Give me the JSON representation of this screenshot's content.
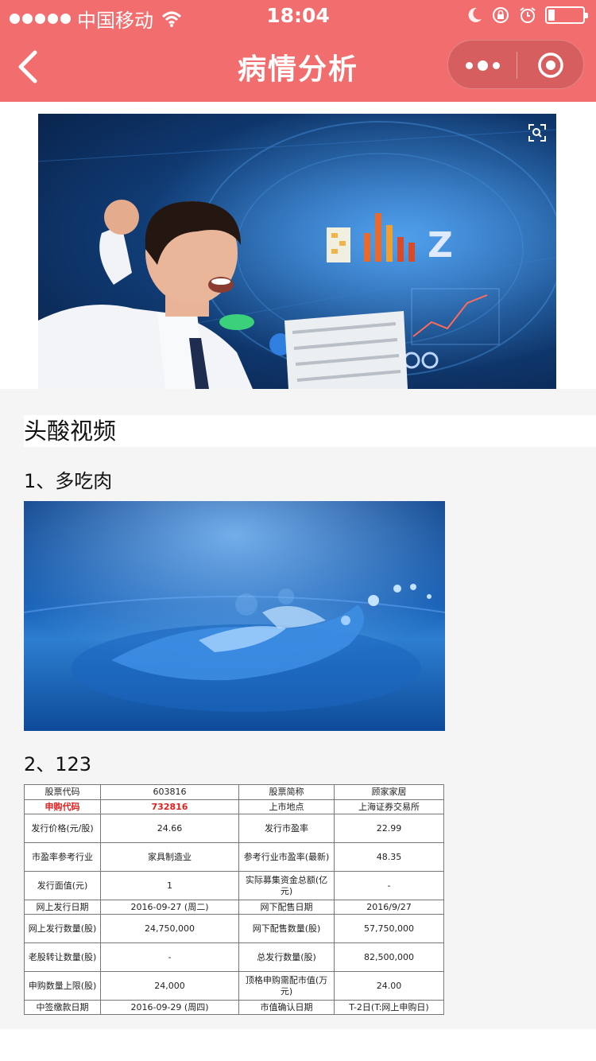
{
  "status_bar": {
    "carrier": "中国移动",
    "time": "18:04"
  },
  "nav": {
    "title": "病情分析"
  },
  "section": {
    "title": "头酸视频"
  },
  "items": [
    {
      "title": "1、多吃肉"
    },
    {
      "title": "2、123"
    }
  ],
  "stock_table": {
    "rows": [
      [
        "股票代码",
        "603816",
        "股票简称",
        "顾家家居"
      ],
      [
        "申购代码",
        "732816",
        "上市地点",
        "上海证券交易所"
      ],
      [
        "发行价格(元/股)",
        "24.66",
        "发行市盈率",
        "22.99"
      ],
      [
        "市盈率参考行业",
        "家具制造业",
        "参考行业市盈率(最新)",
        "48.35"
      ],
      [
        "发行面值(元)",
        "1",
        "实际募集资金总额(亿元)",
        "-"
      ],
      [
        "网上发行日期",
        "2016-09-27 (周二)",
        "网下配售日期",
        "2016/9/27"
      ],
      [
        "网上发行数量(股)",
        "24,750,000",
        "网下配售数量(股)",
        "57,750,000"
      ],
      [
        "老股转让数量(股)",
        "-",
        "总发行数量(股)",
        "82,500,000"
      ],
      [
        "申购数量上限(股)",
        "24,000",
        "顶格申购需配市值(万元)",
        "24.00"
      ],
      [
        "中签缴款日期",
        "2016-09-29 (周四)",
        "市值确认日期",
        "T-2日(T:网上申购日)"
      ]
    ]
  },
  "colors": {
    "nav_bg": "#f26e6e",
    "content_bg": "#f5f5f5",
    "highlight": "#e02020"
  }
}
